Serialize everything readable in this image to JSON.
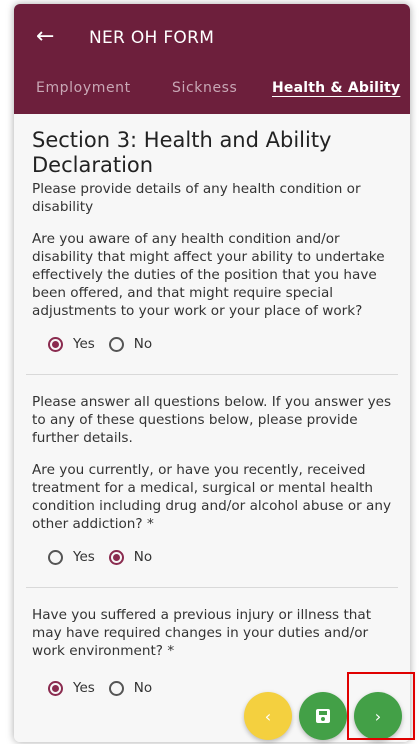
{
  "app": {
    "title": "NER OH FORM"
  },
  "icons": {
    "back": "arrow-left-icon",
    "prev": "chevron-left-icon",
    "save": "floppy-disk-icon",
    "next": "chevron-right-icon"
  },
  "tabs": [
    {
      "label": "Employment"
    },
    {
      "label": "Sickness"
    },
    {
      "label": "Health & Ability"
    }
  ],
  "section": {
    "title": "Section 3: Health and Ability Declaration",
    "description": "Please provide details of any health condition or disability"
  },
  "questions": [
    {
      "text": "Are you aware of any health condition and/or disability that might affect your ability to undertake effectively the duties of the position that you have been offered, and that might require special adjustments to your work or your place of work?",
      "yes": "Yes",
      "no": "No",
      "selected": "Yes"
    },
    {
      "intro": "Please answer all questions below. If you answer yes to any of these questions below, please provide further details.",
      "text": "Are you currently, or have you recently, received treatment for a medical, surgical or mental health condition including drug and/or alcohol abuse or any other addiction? *",
      "yes": "Yes",
      "no": "No",
      "selected": "No"
    },
    {
      "text": "Have you suffered a previous injury or illness that may have required changes in your duties and/or work environment? *",
      "yes": "Yes",
      "no": "No",
      "selected": "Yes"
    }
  ],
  "colors": {
    "header": "#6d1f3c",
    "accent": "#8a2b4f",
    "prev_fab": "#f4d03f",
    "save_fab": "#43a047",
    "next_fab": "#43a047",
    "highlight": "#e00000"
  }
}
